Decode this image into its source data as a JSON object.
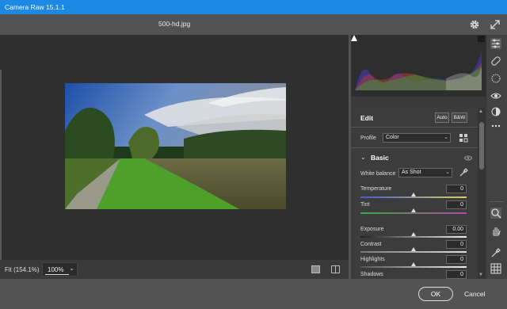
{
  "window": {
    "title": "Camera Raw 15.1.1"
  },
  "header": {
    "filename": "500-hd.jpg"
  },
  "canvas": {
    "fit_label": "Fit (154.1%)",
    "zoom_value": "100%"
  },
  "panel": {
    "edit_title": "Edit",
    "auto_label": "Auto",
    "bw_label": "B&W",
    "profile_label": "Profile",
    "profile_value": "Color",
    "basic_title": "Basic",
    "white_balance_label": "White balance",
    "white_balance_value": "As Shot",
    "sliders": [
      {
        "label": "Temperature",
        "value": "0"
      },
      {
        "label": "Tint",
        "value": "0"
      },
      {
        "label": "Exposure",
        "value": "0.00"
      },
      {
        "label": "Contrast",
        "value": "0"
      },
      {
        "label": "Highlights",
        "value": "0"
      },
      {
        "label": "Shadows",
        "value": "0"
      }
    ]
  },
  "footer": {
    "ok_label": "OK",
    "cancel_label": "Cancel"
  },
  "colors": {
    "titlebar": "#1e88e5",
    "accent": "#ffffff"
  }
}
